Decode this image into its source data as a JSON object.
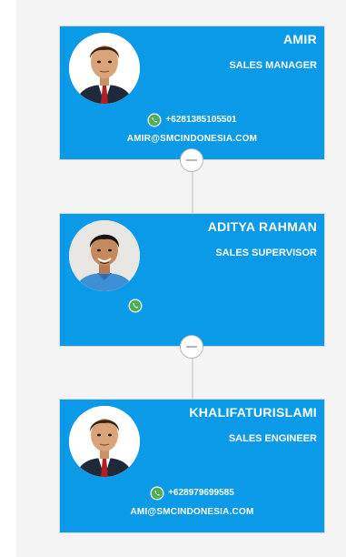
{
  "colors": {
    "card_bg": "#0a9ae8",
    "panel_bg": "#f4f4f4",
    "connector": "#d9d9d9",
    "text": "#ffffff",
    "whatsapp": "#4caf50"
  },
  "icons": {
    "whatsapp": "whatsapp-icon",
    "collapse": "minus-circle-icon"
  },
  "cards": [
    {
      "name": "AMIR",
      "title": "SALES MANAGER",
      "phone": "+6281385105501",
      "email": "AMIR@SMCINDONESIA.COM"
    },
    {
      "name": "ADITYA RAHMAN",
      "title": "SALES SUPERVISOR"
    },
    {
      "name": "KHALIFATURISLAMI",
      "title": "SALES ENGINEER",
      "phone": "+628979699585",
      "email": "AMI@SMCINDONESIA.COM"
    }
  ]
}
